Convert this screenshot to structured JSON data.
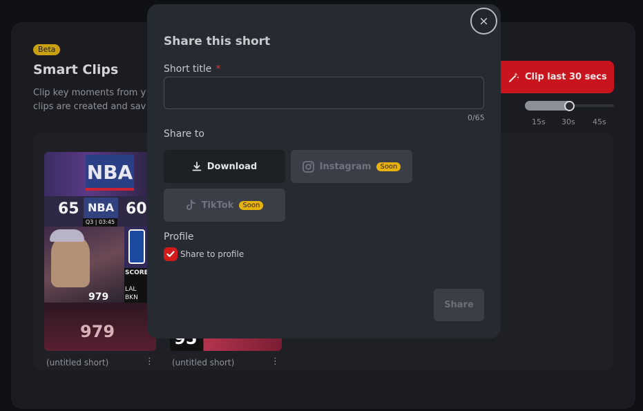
{
  "page": {
    "badge": "Beta",
    "title": "Smart Clips",
    "description_line1": "Clip key moments from y",
    "description_line2": "clips are created and sav",
    "clip_button_label": "Clip last 30 secs",
    "clip_length": {
      "options": [
        "15s",
        "30s",
        "45s"
      ],
      "selected": "30s"
    },
    "clips": [
      {
        "title": "(untitled short)",
        "menu": "⋮"
      },
      {
        "title": "(untitled short)",
        "menu": "⋮"
      }
    ],
    "thumb_left": {
      "score_home": "65",
      "score_away": "60",
      "clock": "Q3 | 03:45",
      "channel_num": "979",
      "teams": [
        "LAL",
        "BKN"
      ],
      "label": "SCORES",
      "logo": "NBA"
    },
    "thumb_right": {
      "score": "95"
    }
  },
  "modal": {
    "title": "Share this short",
    "close_icon": "×",
    "field_label": "Short title",
    "required_marker": "*",
    "title_value": "",
    "counter": "0/65",
    "share_to_label": "Share to",
    "destinations": {
      "download": "Download",
      "instagram": "Instagram",
      "tiktok": "TikTok",
      "soon": "Soon"
    },
    "profile_label": "Profile",
    "share_to_profile_label": "Share to profile",
    "share_to_profile_checked": true,
    "submit_label": "Share"
  },
  "colors": {
    "accent_red": "#c8141d",
    "soon_yellow": "#e8b20d",
    "modal_bg": "#262a31"
  }
}
